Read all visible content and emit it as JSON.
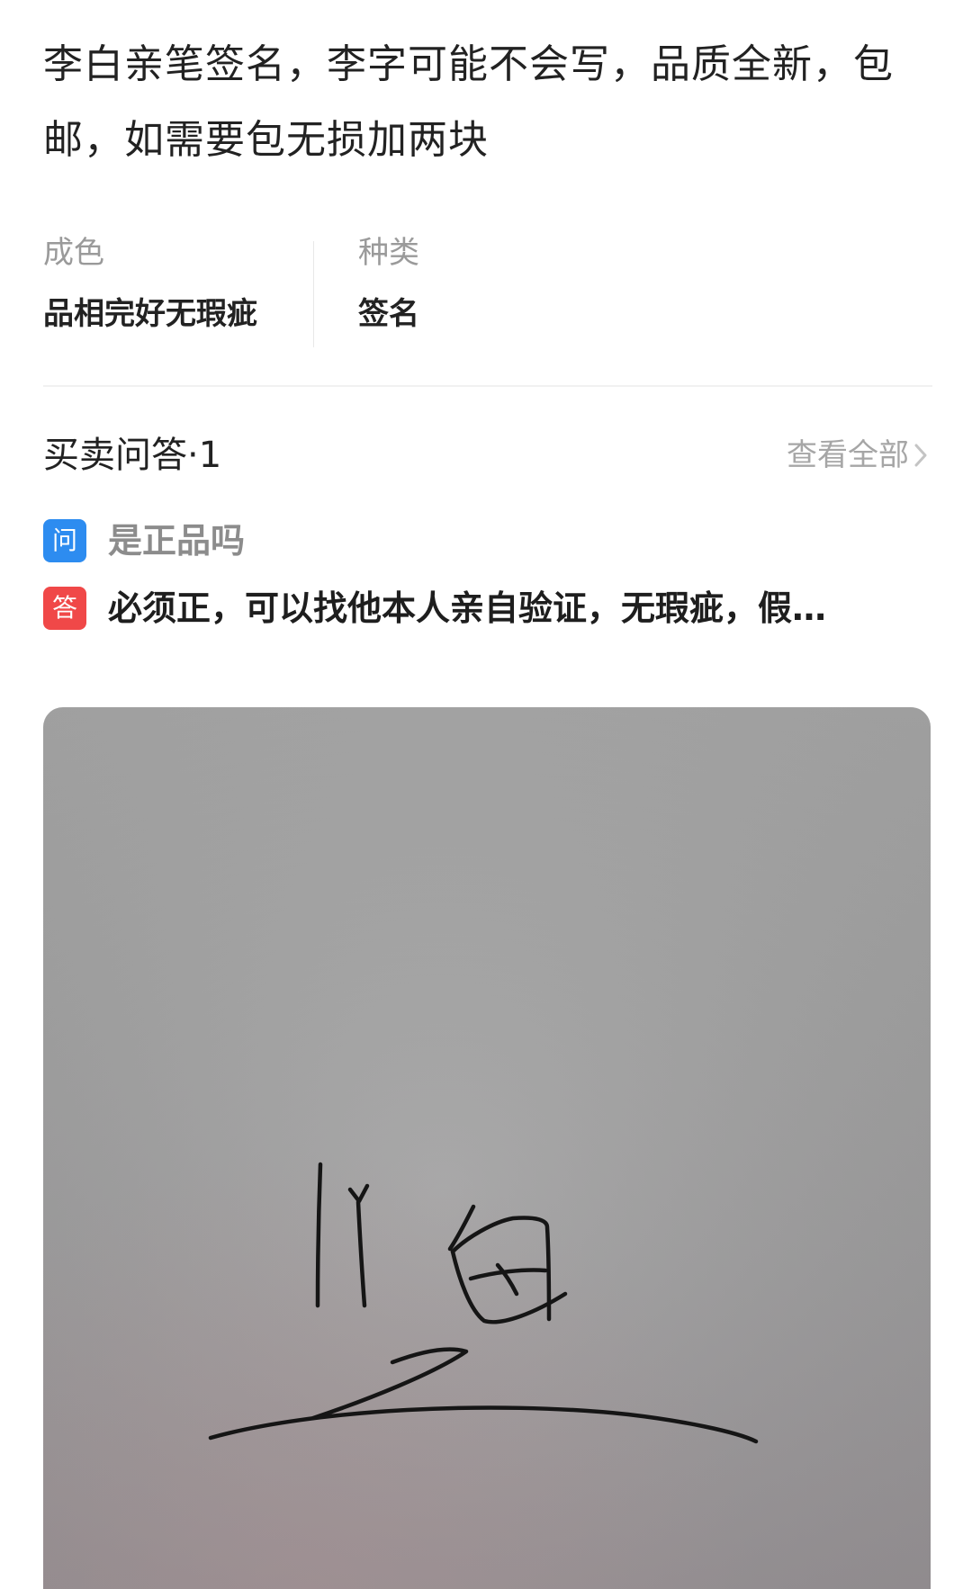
{
  "listing": {
    "description": "李白亲笔签名，李字可能不会写，品质全新，包邮，如需要包无损加两块"
  },
  "attributes": {
    "condition_label": "成色",
    "condition_value": "品相完好无瑕疵",
    "category_label": "种类",
    "category_value": "签名"
  },
  "qa": {
    "title": "买卖问答·1",
    "view_all_label": "查看全部",
    "question_badge": "问",
    "question": "是正品吗",
    "answer_badge": "答",
    "answer": "必须正，可以找他本人亲自验证，无瑕疵，假…"
  },
  "photo": {
    "signature_text": "li 白"
  },
  "colors": {
    "question_badge": "#2d8cf0",
    "answer_badge": "#f04848",
    "muted_text": "#9a9a9a"
  }
}
